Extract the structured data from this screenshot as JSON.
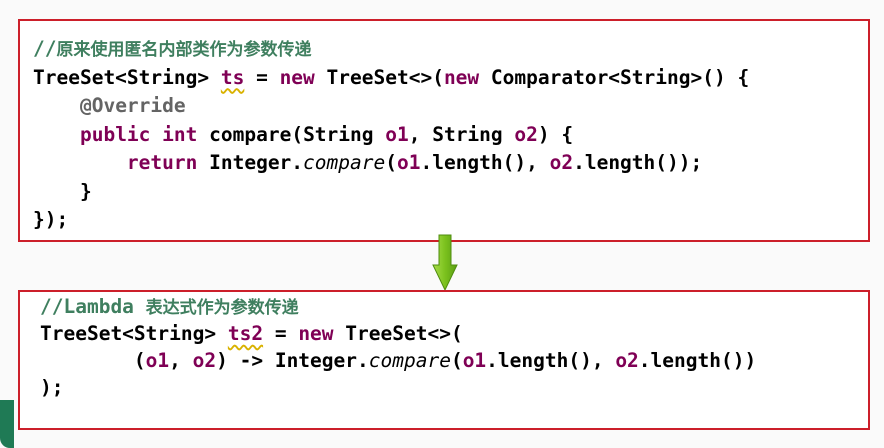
{
  "top_panel": {
    "comment_prefix": "//",
    "comment_text": "原来使用匿名内部类作为参数传递",
    "line2": {
      "t1": "TreeSet<String> ",
      "var": "ts",
      "t2": " = ",
      "kw_new1": "new",
      "t3": " TreeSet<>(",
      "kw_new2": "new",
      "t4": " Comparator<String>() {"
    },
    "line3": {
      "indent": "    ",
      "annotation": "@Override"
    },
    "line4": {
      "indent": "    ",
      "kw_public": "public",
      "sp1": " ",
      "kw_int": "int",
      "t1": " compare(String ",
      "p1": "o1",
      "t2": ", String ",
      "p2": "o2",
      "t3": ") {"
    },
    "line5": {
      "indent": "        ",
      "kw_return": "return",
      "t1": " Integer.",
      "method": "compare",
      "t2": "(",
      "p1": "o1",
      "t3": ".length(), ",
      "p2": "o2",
      "t4": ".length());"
    },
    "line6": {
      "text": "    }"
    },
    "line7": {
      "text": "});"
    }
  },
  "bottom_panel": {
    "comment_prefix": "//Lambda ",
    "comment_text": "表达式作为参数传递",
    "line2": {
      "t1": "TreeSet<String> ",
      "var": "ts2",
      "t2": " = ",
      "kw_new": "new",
      "t3": " TreeSet<>("
    },
    "line3": {
      "indent": "        (",
      "p1": "o1",
      "t1": ", ",
      "p2": "o2",
      "t2": ") -> Integer.",
      "method": "compare",
      "t3": "(",
      "p3": "o1",
      "t4": ".length(), ",
      "p4": "o2",
      "t5": ".length())"
    },
    "line4": {
      "text": ");"
    }
  },
  "arrow": {
    "icon": "down-arrow-icon",
    "color": "#7cc21e"
  },
  "colors": {
    "border": "#cc1f2a",
    "keyword": "#7f0055",
    "comment": "#3f7f5f",
    "annotation": "#646464"
  }
}
